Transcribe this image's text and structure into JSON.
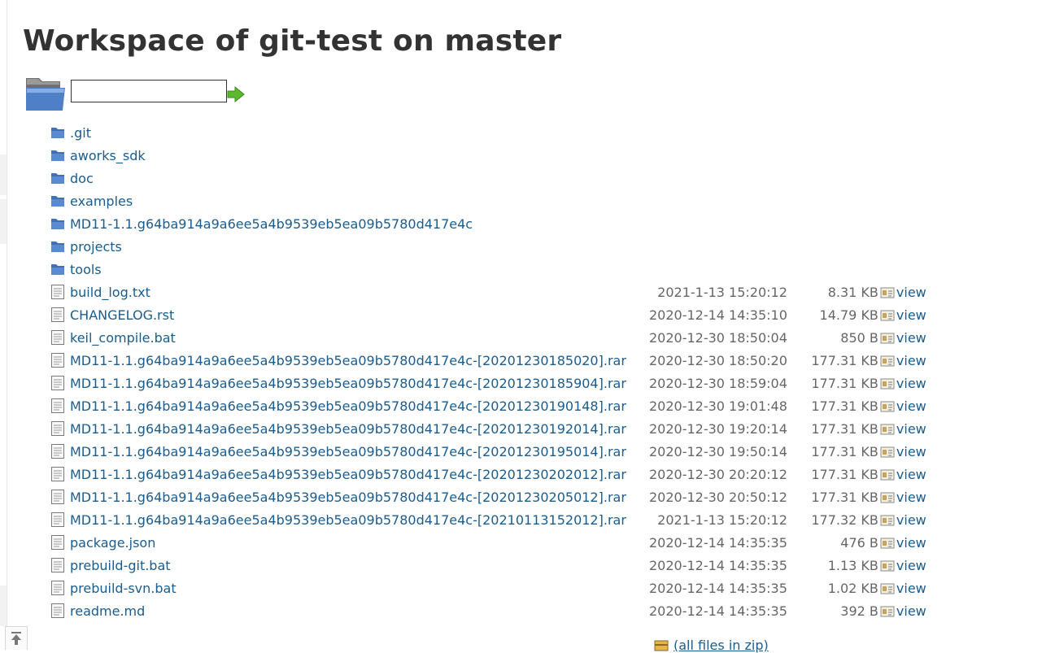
{
  "page": {
    "title": "Workspace of git-test on master",
    "path_input_value": "",
    "zip_link": "(all files in zip)"
  },
  "icons": {
    "folder": "folder-icon",
    "file": "file-icon",
    "fingerprint": "fingerprint-icon",
    "go": "go-arrow-icon",
    "scroll_top": "scroll-to-top-icon",
    "zip": "zip-icon"
  },
  "colors": {
    "link": "#1a5c8d",
    "text": "#333333",
    "muted": "#666666",
    "folder": "#5a8ad0",
    "go_arrow": "#5cb82e"
  },
  "folders": [
    {
      "name": ".git"
    },
    {
      "name": "aworks_sdk"
    },
    {
      "name": "doc"
    },
    {
      "name": "examples"
    },
    {
      "name": "MD11-1.1.g64ba914a9a6ee5a4b9539eb5ea09b5780d417e4c"
    },
    {
      "name": "projects"
    },
    {
      "name": "tools"
    }
  ],
  "files": [
    {
      "name": "build_log.txt",
      "date": "2021-1-13 15:20:12",
      "size": "8.31 KB",
      "view": "view"
    },
    {
      "name": "CHANGELOG.rst",
      "date": "2020-12-14 14:35:10",
      "size": "14.79 KB",
      "view": "view"
    },
    {
      "name": "keil_compile.bat",
      "date": "2020-12-30 18:50:04",
      "size": "850 B",
      "view": "view"
    },
    {
      "name": "MD11-1.1.g64ba914a9a6ee5a4b9539eb5ea09b5780d417e4c-[20201230185020].rar",
      "date": "2020-12-30 18:50:20",
      "size": "177.31 KB",
      "view": "view"
    },
    {
      "name": "MD11-1.1.g64ba914a9a6ee5a4b9539eb5ea09b5780d417e4c-[20201230185904].rar",
      "date": "2020-12-30 18:59:04",
      "size": "177.31 KB",
      "view": "view"
    },
    {
      "name": "MD11-1.1.g64ba914a9a6ee5a4b9539eb5ea09b5780d417e4c-[20201230190148].rar",
      "date": "2020-12-30 19:01:48",
      "size": "177.31 KB",
      "view": "view"
    },
    {
      "name": "MD11-1.1.g64ba914a9a6ee5a4b9539eb5ea09b5780d417e4c-[20201230192014].rar",
      "date": "2020-12-30 19:20:14",
      "size": "177.31 KB",
      "view": "view"
    },
    {
      "name": "MD11-1.1.g64ba914a9a6ee5a4b9539eb5ea09b5780d417e4c-[20201230195014].rar",
      "date": "2020-12-30 19:50:14",
      "size": "177.31 KB",
      "view": "view"
    },
    {
      "name": "MD11-1.1.g64ba914a9a6ee5a4b9539eb5ea09b5780d417e4c-[20201230202012].rar",
      "date": "2020-12-30 20:20:12",
      "size": "177.31 KB",
      "view": "view"
    },
    {
      "name": "MD11-1.1.g64ba914a9a6ee5a4b9539eb5ea09b5780d417e4c-[20201230205012].rar",
      "date": "2020-12-30 20:50:12",
      "size": "177.31 KB",
      "view": "view"
    },
    {
      "name": "MD11-1.1.g64ba914a9a6ee5a4b9539eb5ea09b5780d417e4c-[20210113152012].rar",
      "date": "2021-1-13 15:20:12",
      "size": "177.32 KB",
      "view": "view"
    },
    {
      "name": "package.json",
      "date": "2020-12-14 14:35:35",
      "size": "476 B",
      "view": "view"
    },
    {
      "name": "prebuild-git.bat",
      "date": "2020-12-14 14:35:35",
      "size": "1.13 KB",
      "view": "view"
    },
    {
      "name": "prebuild-svn.bat",
      "date": "2020-12-14 14:35:35",
      "size": "1.02 KB",
      "view": "view"
    },
    {
      "name": "readme.md",
      "date": "2020-12-14 14:35:35",
      "size": "392 B",
      "view": "view"
    }
  ]
}
